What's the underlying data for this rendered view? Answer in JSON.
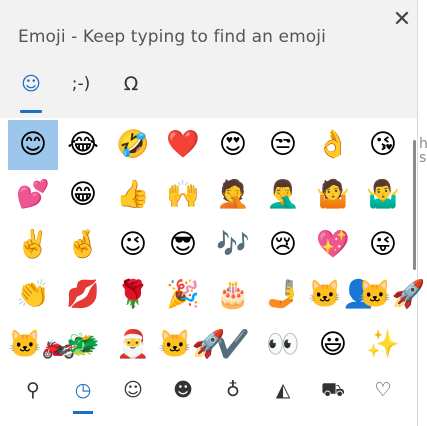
{
  "window": {
    "title": "Emoji - Keep typing to find an emoji",
    "close_glyph": "✕"
  },
  "tabs": [
    {
      "name": "emoji",
      "glyph": "☺",
      "active": true
    },
    {
      "name": "kaomoji",
      "glyph": ";-)",
      "active": false
    },
    {
      "name": "symbols",
      "glyph": "Ω",
      "active": false
    }
  ],
  "emoji_grid": [
    [
      "😊",
      "😂",
      "🤣",
      "❤️",
      "😍",
      "😒",
      "👌",
      "😘"
    ],
    [
      "💕",
      "😁",
      "👍",
      "🙌",
      "🤦",
      "🤦‍♂️",
      "🤷",
      "🤷‍♂️"
    ],
    [
      "✌️",
      "🤞",
      "😉",
      "😎",
      "🎶",
      "😢",
      "💖",
      "😜"
    ],
    [
      "👏",
      "💋",
      "🌹",
      "🎉",
      "🎂",
      "🤳",
      "🐱‍👤",
      "🐱‍🚀"
    ],
    [
      "🐱‍🏍",
      "🐲",
      "🎅",
      "🐱‍🚀",
      "✔️",
      "👀",
      "😃",
      "✨"
    ]
  ],
  "selected_emoji": "😊",
  "categories": [
    {
      "name": "search",
      "glyph": "⚲",
      "active": false
    },
    {
      "name": "recent",
      "glyph": "◷",
      "active": true
    },
    {
      "name": "smileys",
      "glyph": "☺",
      "active": false
    },
    {
      "name": "people",
      "glyph": "☻",
      "active": false
    },
    {
      "name": "celebrations",
      "glyph": "♁",
      "active": false
    },
    {
      "name": "food",
      "glyph": "◭",
      "active": false
    },
    {
      "name": "transport",
      "glyph": "⛟",
      "active": false
    },
    {
      "name": "hearts",
      "glyph": "♡",
      "active": false
    }
  ],
  "colors": {
    "accent": "#1a6fc9",
    "selected_cell": "#9cc6ec",
    "header_bg": "#f2f2f2"
  },
  "background_text": [
    "h",
    "s"
  ]
}
